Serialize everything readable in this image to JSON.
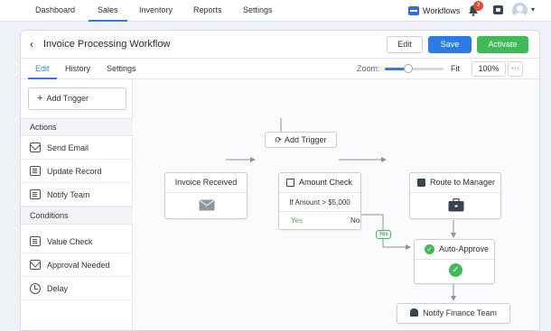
{
  "topnav": {
    "items": [
      "Dashboard",
      "Sales",
      "Inventory",
      "Reports",
      "Settings"
    ],
    "active": "Sales",
    "workflows_label": "Workflows",
    "notification_count": "3"
  },
  "header": {
    "title": "Invoice Processing Workflow",
    "edit_label": "Edit",
    "save_label": "Save",
    "activate_label": "Activate"
  },
  "tabs": {
    "items": [
      "Edit",
      "History",
      "Settings"
    ],
    "active": "Edit",
    "zoom_label": "Zoom:",
    "zoom_level_fraction": 0.4,
    "fit_label": "Fit",
    "zoom_value": "100%",
    "more_label": "···"
  },
  "sidebar": {
    "add_trigger": "Add Trigger",
    "actions_title": "Actions",
    "actions": [
      "Send Email",
      "Update Record",
      "Notify Team"
    ],
    "conditions_title": "Conditions",
    "conditions": [
      "Value Check",
      "Approval Needed",
      "Delay"
    ]
  },
  "canvas": {
    "add_trigger": "Add Trigger",
    "invoice_received": "Invoice Received",
    "amount_check": "Amount Check",
    "amount_condition": "If Amount > $5,000",
    "yes_label": "Yes",
    "no_label": "No",
    "yes_badge": "Yes",
    "route_to_manager": "Route to Manager",
    "auto_approve": "Auto-Approve",
    "notify_finance": "Notify Finance Team"
  },
  "colors": {
    "primary": "#2d7be5",
    "success": "#3fba56",
    "danger": "#e5483b"
  }
}
